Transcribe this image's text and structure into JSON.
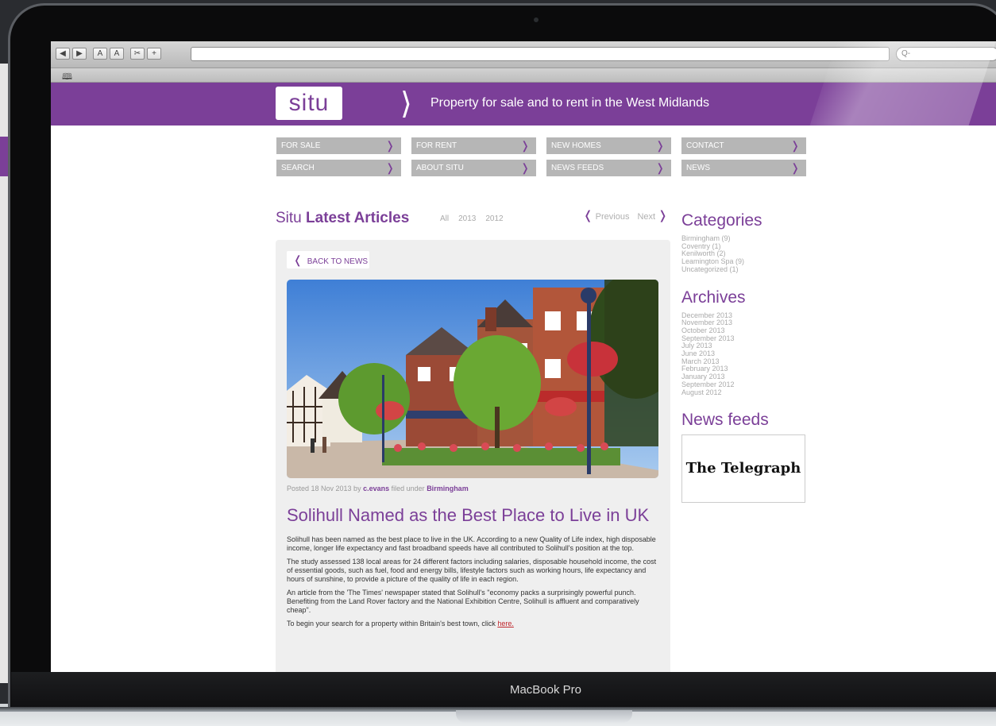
{
  "device": {
    "model_label": "MacBook Pro"
  },
  "browser": {
    "buttons": [
      "◀",
      "▶",
      "A",
      "A",
      "✂",
      "+"
    ],
    "search_placeholder": "Q-",
    "bookmarks_icon": "book-icon"
  },
  "site": {
    "logo": "situ",
    "tagline": "Property for sale and to rent in the West Midlands",
    "accent_color": "#7b3f98"
  },
  "nav": [
    {
      "label": "For Sale"
    },
    {
      "label": "For Rent"
    },
    {
      "label": "New Homes"
    },
    {
      "label": "Contact"
    },
    {
      "label": "Search"
    },
    {
      "label": "About Situ"
    },
    {
      "label": "News Feeds"
    },
    {
      "label": "News"
    }
  ],
  "articles": {
    "title_prefix": "Situ",
    "title_bold": "Latest Articles",
    "filters": [
      "All",
      "2013",
      "2012"
    ],
    "previous": "Previous",
    "next": "Next"
  },
  "article": {
    "back_label": "BACK TO NEWS",
    "posted_prefix": "Posted 18 Nov 2013 by",
    "author": "c.evans",
    "filed": "filed under",
    "category": "Birmingham",
    "headline": "Solihull Named as the Best Place to Live in UK",
    "paragraphs": [
      "Solihull has been named as the best place to live in the UK. According to a new Quality of Life index, high disposable income, longer life expectancy and fast broadband speeds have all contributed to Solihull's position at the top.",
      "The study assessed 138 local areas for 24 different factors including salaries, disposable household income, the cost of essential goods, such as fuel, food and energy bills, lifestyle factors such as working hours, life expectancy and hours of sunshine, to provide a picture of the quality of life in each region.",
      "An article from the 'The Times' newspaper stated that Solihull's \"economy packs a surprisingly powerful punch. Benefiting from the Land Rover factory and the National Exhibition Centre, Solihull is affluent and comparatively cheap\"."
    ],
    "cta_text": "To begin your search for a property within Britain's best town, click",
    "cta_link": "here."
  },
  "sidebar": {
    "categories_title": "Categories",
    "categories": [
      "Birmingham (9)",
      "Coventry (1)",
      "Kenilworth (2)",
      "Leamington Spa (9)",
      "Uncategorized (1)"
    ],
    "archives_title": "Archives",
    "archives": [
      "December 2013",
      "November 2013",
      "October 2013",
      "September 2013",
      "July 2013",
      "June 2013",
      "March 2013",
      "February 2013",
      "January 2013",
      "September 2012",
      "August 2012"
    ],
    "newsfeeds_title": "News feeds",
    "feed_logo": "The Telegraph"
  }
}
